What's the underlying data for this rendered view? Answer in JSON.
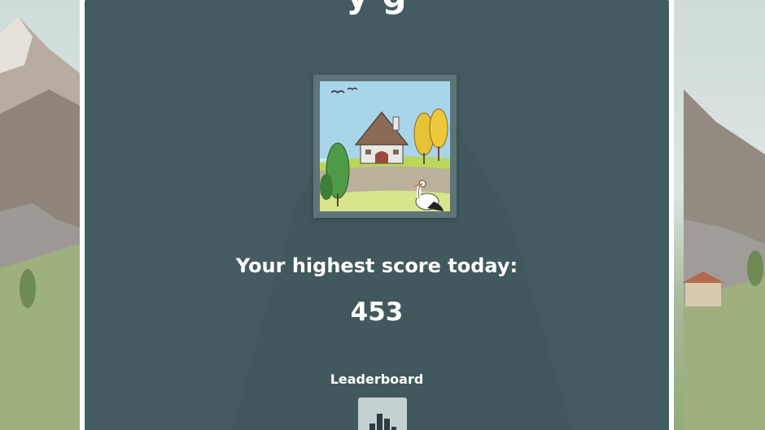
{
  "header": {
    "title_partial": "y  g"
  },
  "puzzle": {
    "thumbnail_alt": "Village puzzle picture: cottage, autumn trees, stork"
  },
  "score": {
    "label": "Your highest score today:",
    "value": "453"
  },
  "leaderboard": {
    "label": "Leaderboard",
    "icon": "bar-chart-icon"
  },
  "colors": {
    "panel": "#445b61",
    "panel_border": "#ffffff",
    "text": "#ffffff",
    "leaderboard_button": "#c5d0d3",
    "leaderboard_icon": "#2f3b3f"
  }
}
